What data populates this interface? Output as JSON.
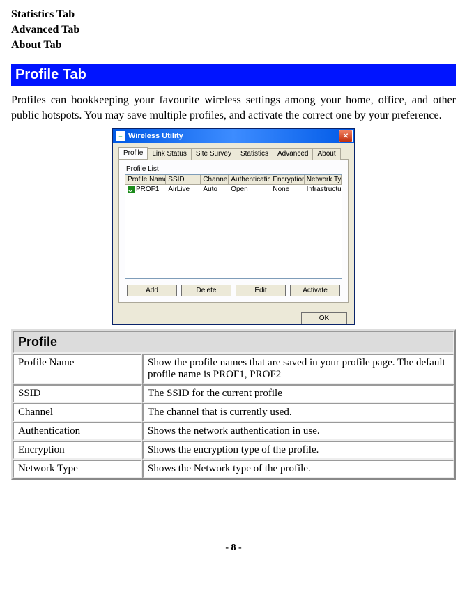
{
  "toc": {
    "items": [
      "Statistics Tab",
      "Advanced Tab",
      "About Tab"
    ]
  },
  "heading": "Profile Tab",
  "paragraph": "Profiles can bookkeeping your favourite wireless settings among your home, office, and other public hotspots. You may save multiple profiles, and activate the correct one by your preference.",
  "dialog": {
    "title": "Wireless Utility",
    "tabs": [
      "Profile",
      "Link Status",
      "Site Survey",
      "Statistics",
      "Advanced",
      "About"
    ],
    "active_tab": 0,
    "group_label": "Profile List",
    "columns": [
      "Profile Name",
      "SSID",
      "Channel",
      "Authentication",
      "Encryption",
      "Network Ty..."
    ],
    "row": {
      "profile_name": "PROF1",
      "ssid": "AirLive",
      "channel": "Auto",
      "auth": "Open",
      "enc": "None",
      "nettype": "Infrastructure"
    },
    "buttons": {
      "add": "Add",
      "delete": "Delete",
      "edit": "Edit",
      "activate": "Activate",
      "ok": "OK"
    }
  },
  "table": {
    "section": "Profile",
    "rows": [
      {
        "k": "Profile Name",
        "v": "Show the profile names that are saved in your profile page. The default profile name is PROF1, PROF2"
      },
      {
        "k": "SSID",
        "v": "The SSID for the current profile"
      },
      {
        "k": "Channel",
        "v": "The channel that is currently used."
      },
      {
        "k": "Authentication",
        "v": "Shows the network authentication in use."
      },
      {
        "k": "Encryption",
        "v": "Shows the encryption type of the profile."
      },
      {
        "k": "Network Type",
        "v": "Shows the Network type of the profile."
      }
    ]
  },
  "page_number": "- 8 -"
}
